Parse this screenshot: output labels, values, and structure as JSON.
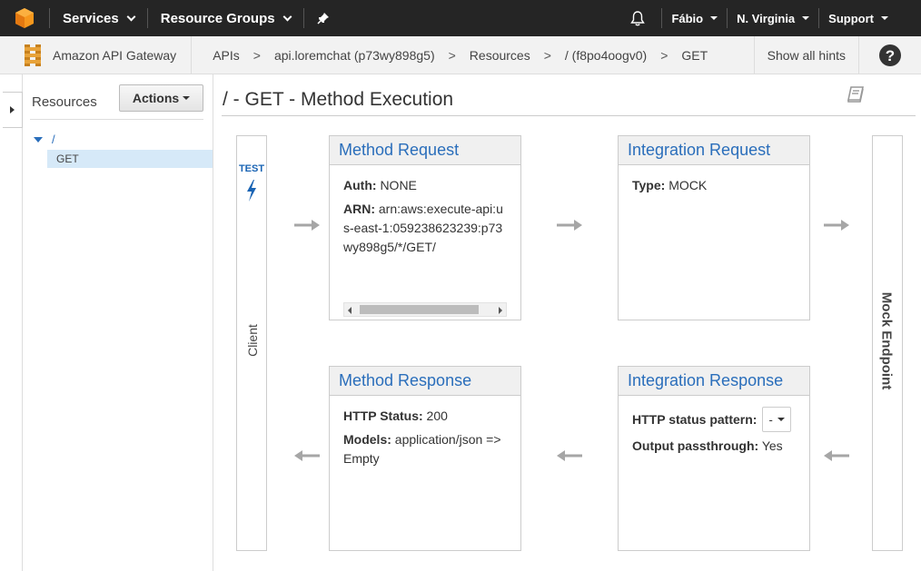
{
  "topnav": {
    "services": "Services",
    "resource_groups": "Resource Groups",
    "user": "Fábio",
    "region": "N. Virginia",
    "support": "Support"
  },
  "breadcrumb": {
    "service_name": "Amazon API Gateway",
    "items": [
      "APIs",
      "api.loremchat (p73wy898g5)",
      "Resources",
      "/ (f8po4oogv0)",
      "GET"
    ],
    "separator": ">",
    "show_hints": "Show all hints"
  },
  "resources": {
    "title": "Resources",
    "actions_label": "Actions",
    "root": "/",
    "method": "GET"
  },
  "main": {
    "title": "/ - GET - Method Execution",
    "client_label": "Client",
    "test_label": "TEST",
    "mock_label": "Mock Endpoint"
  },
  "method_request": {
    "title": "Method Request",
    "auth_label": "Auth:",
    "auth_value": "NONE",
    "arn_label": "ARN:",
    "arn_value": "arn:aws:execute-api:us-east-1:059238623239:p73wy898g5/*/GET/"
  },
  "integration_request": {
    "title": "Integration Request",
    "type_label": "Type:",
    "type_value": "MOCK"
  },
  "method_response": {
    "title": "Method Response",
    "status_label": "HTTP Status:",
    "status_value": "200",
    "models_label": "Models:",
    "models_value": "application/json => Empty"
  },
  "integration_response": {
    "title": "Integration Response",
    "pattern_label": "HTTP status pattern:",
    "pattern_value": "-",
    "passthrough_label": "Output passthrough:",
    "passthrough_value": "Yes"
  },
  "colors": {
    "nav_bg": "#252525",
    "link_blue": "#2a6ebb",
    "selected_bg": "#d6e9f8",
    "arrow_gray": "#a6a6a6"
  }
}
